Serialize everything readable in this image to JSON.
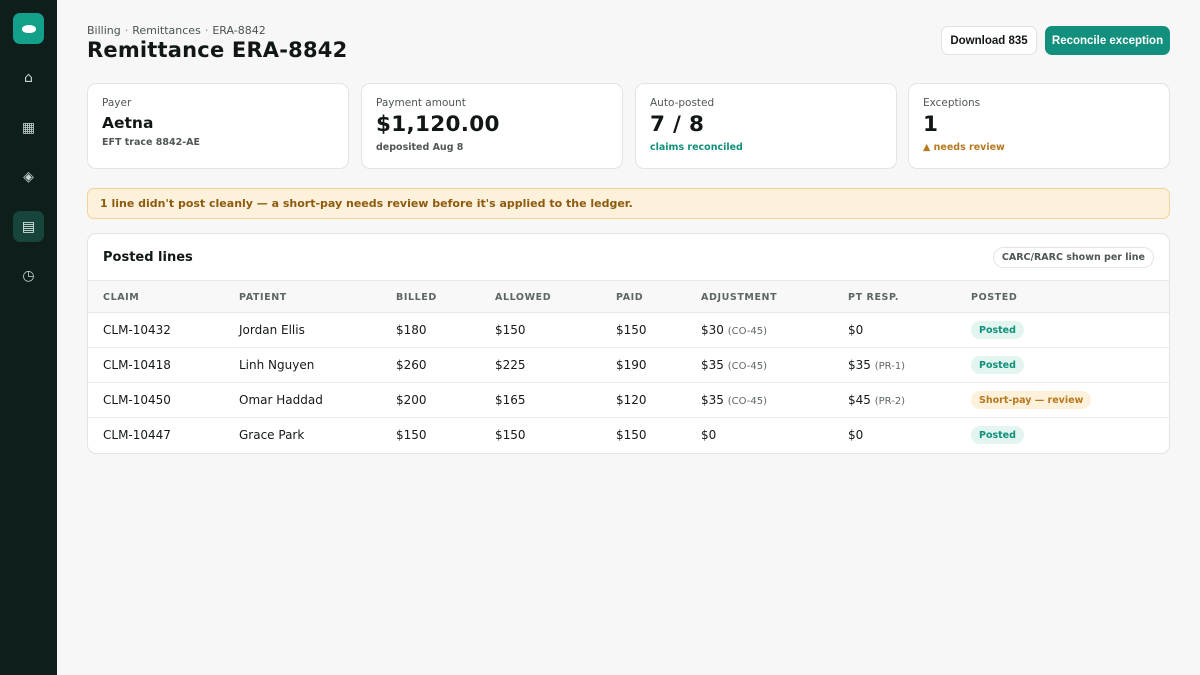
{
  "sidebar": {
    "items": [
      {
        "icon": "home-icon",
        "glyph": "⌂"
      },
      {
        "icon": "grid-icon",
        "glyph": "▦"
      },
      {
        "icon": "diamond-icon",
        "glyph": "◈"
      },
      {
        "icon": "document-icon",
        "glyph": "▤",
        "active": true
      },
      {
        "icon": "clock-icon",
        "glyph": "◷"
      }
    ]
  },
  "header": {
    "breadcrumb": [
      "Billing",
      "Remittances",
      "ERA-8842"
    ],
    "separator": "·",
    "title": "Remittance ERA-8842",
    "download_label": "Download 835",
    "reconcile_label": "Reconcile exception"
  },
  "stats": {
    "payer": {
      "label": "Payer",
      "value": "Aetna",
      "sub": "EFT trace 8842-AE"
    },
    "payment": {
      "label": "Payment amount",
      "value": "$1,120.00",
      "sub": "deposited Aug 8"
    },
    "auto_posted": {
      "label": "Auto-posted",
      "value": "7 / 8",
      "sub": "claims reconciled"
    },
    "exceptions": {
      "label": "Exceptions",
      "value": "1",
      "sub": "▲ needs review"
    }
  },
  "banner": {
    "text": "1 line didn't post cleanly — a short-pay needs review before it's applied to the ledger."
  },
  "table": {
    "title": "Posted lines",
    "chip": "CARC/RARC shown per line",
    "columns": [
      "CLAIM",
      "PATIENT",
      "BILLED",
      "ALLOWED",
      "PAID",
      "ADJUSTMENT",
      "PT RESP.",
      "POSTED"
    ],
    "rows": [
      {
        "claim": "CLM-10432",
        "patient": "Jordan Ellis",
        "billed": "$180",
        "allowed": "$150",
        "paid": "$150",
        "adjustment": "$30",
        "adj_code": "(CO-45)",
        "pt_resp": "$0",
        "pt_code": "",
        "posted": "Posted",
        "status": "posted"
      },
      {
        "claim": "CLM-10418",
        "patient": "Linh Nguyen",
        "billed": "$260",
        "allowed": "$225",
        "paid": "$190",
        "adjustment": "$35",
        "adj_code": "(CO-45)",
        "pt_resp": "$35",
        "pt_code": "(PR-1)",
        "posted": "Posted",
        "status": "posted"
      },
      {
        "claim": "CLM-10450",
        "patient": "Omar Haddad",
        "billed": "$200",
        "allowed": "$165",
        "paid": "$120",
        "adjustment": "$35",
        "adj_code": "(CO-45)",
        "pt_resp": "$45",
        "pt_code": "(PR-2)",
        "posted": "Short-pay — review",
        "status": "short"
      },
      {
        "claim": "CLM-10447",
        "patient": "Grace Park",
        "billed": "$150",
        "allowed": "$150",
        "paid": "$150",
        "adjustment": "$0",
        "adj_code": "",
        "pt_resp": "$0",
        "pt_code": "",
        "posted": "Posted",
        "status": "posted"
      }
    ]
  },
  "colors": {
    "sidebar": "#0e1f1b",
    "accent": "#13907d",
    "success": "#119079",
    "warning": "#b7791f",
    "banner_bg": "#fdf1dc"
  }
}
